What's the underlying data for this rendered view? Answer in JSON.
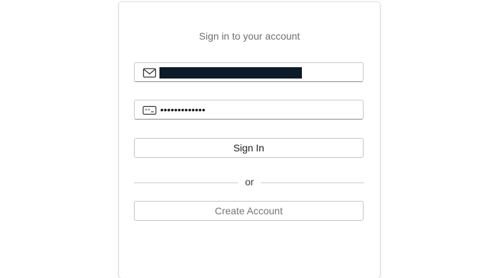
{
  "login": {
    "title": "Sign in to your account",
    "email": {
      "value": "",
      "icon": "envelope-icon",
      "redacted": true
    },
    "password": {
      "value": "•••••••••••••",
      "icon": "password-key-icon"
    },
    "sign_in_label": "Sign In",
    "divider_text": "or",
    "create_account_label": "Create Account"
  },
  "colors": {
    "title_text": "#6f6f6f",
    "button_text": "#1c1c1c",
    "secondary_button_text": "#757575",
    "border": "#c9c9c9",
    "redaction": "#0b1b2a"
  }
}
